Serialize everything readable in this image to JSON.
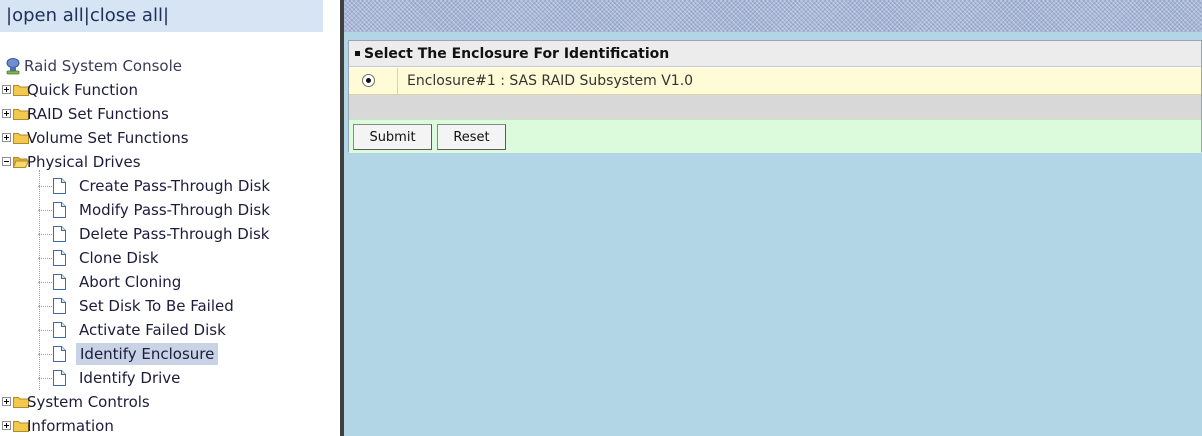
{
  "topbar": {
    "prefix": "|",
    "open_all": "open all",
    "sep": "|",
    "close_all": "close all",
    "suffix": "|"
  },
  "tree": {
    "root_label": "Raid System Console",
    "folders": {
      "quick_function": "Quick Function",
      "raid_set_functions": "RAID Set Functions",
      "volume_set_functions": "Volume Set Functions",
      "physical_drives": "Physical Drives",
      "system_controls": "System Controls",
      "information": "Information"
    },
    "physical_drive_items": [
      "Create Pass-Through Disk",
      "Modify Pass-Through Disk",
      "Delete Pass-Through Disk",
      "Clone Disk",
      "Abort Cloning",
      "Set Disk To Be Failed",
      "Activate Failed Disk",
      "Identify Enclosure",
      "Identify Drive"
    ],
    "selected_item": "Identify Enclosure"
  },
  "panel": {
    "title": "Select The Enclosure For Identification",
    "enclosure_label": "Enclosure#1 : SAS RAID Subsystem V1.0",
    "enclosure_selected": true,
    "submit_label": "Submit",
    "reset_label": "Reset"
  },
  "colors": {
    "topbar_bg": "#d6e4f4",
    "content_bg": "#b3d6e6",
    "enclosure_row_bg": "#fffbd6",
    "button_row_bg": "#dcfadc",
    "selected_item_bg": "#c9d3e6",
    "folder_yellow": "#f2c94c"
  },
  "icons": {
    "root": "computer-icon",
    "folder": "folder-icon",
    "folder_open": "folder-open-icon",
    "page": "document-icon"
  }
}
